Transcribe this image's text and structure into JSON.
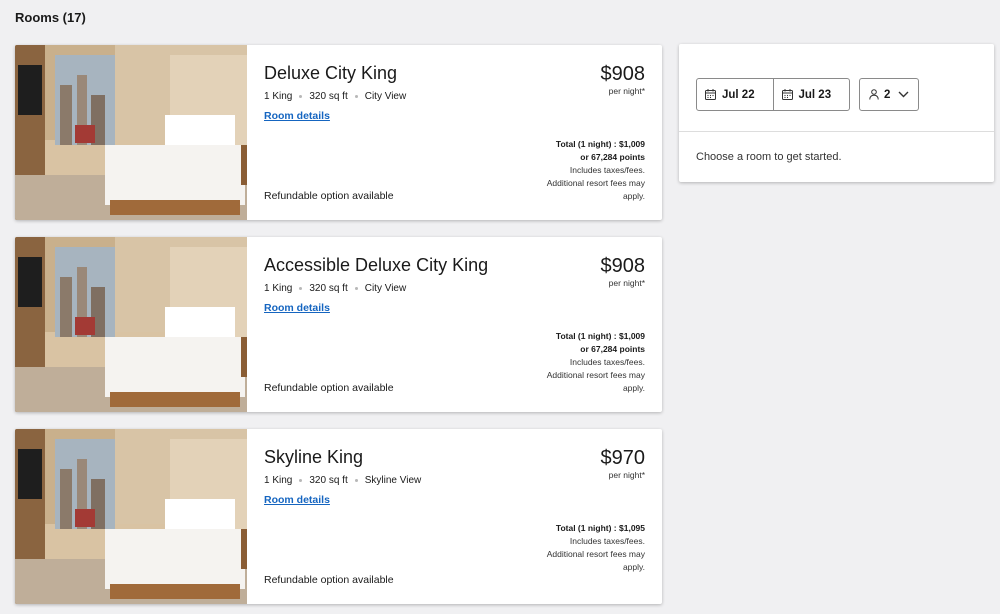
{
  "page": {
    "rooms_heading": "Rooms (17)"
  },
  "rooms": [
    {
      "name": "Deluxe City King",
      "bed": "1 King",
      "size": "320 sq ft",
      "view": "City View",
      "details_link": "Room details",
      "price": "$908",
      "per_night": "per night*",
      "total_line": "Total (1 night) :  $1,009",
      "points_line": "or 67,284 points",
      "taxes_line": "Includes taxes/fees.",
      "resort_line1": "Additional resort fees may",
      "resort_line2": "apply.",
      "refundable": "Refundable option available"
    },
    {
      "name": "Accessible Deluxe City King",
      "bed": "1 King",
      "size": "320 sq ft",
      "view": "City View",
      "details_link": "Room details",
      "price": "$908",
      "per_night": "per night*",
      "total_line": "Total (1 night) :  $1,009",
      "points_line": "or 67,284 points",
      "taxes_line": "Includes taxes/fees.",
      "resort_line1": "Additional resort fees may",
      "resort_line2": "apply.",
      "refundable": "Refundable option available"
    },
    {
      "name": "Skyline King",
      "bed": "1 King",
      "size": "320 sq ft",
      "view": "Skyline View",
      "details_link": "Room details",
      "price": "$970",
      "per_night": "per night*",
      "total_line": "Total (1 night) :  $1,095",
      "taxes_line": "Includes taxes/fees.",
      "resort_line1": "Additional resort fees may",
      "resort_line2": "apply.",
      "refundable": "Refundable option available"
    }
  ],
  "booking": {
    "check_in": "Jul 22",
    "check_out": "Jul 23",
    "guests": "2",
    "message": "Choose a room to get started."
  },
  "icons": {
    "calendar": "calendar-icon",
    "person": "person-icon",
    "chevron": "chevron-down-icon"
  },
  "colors": {
    "link": "#1565c0",
    "background": "#f0f0f2"
  }
}
